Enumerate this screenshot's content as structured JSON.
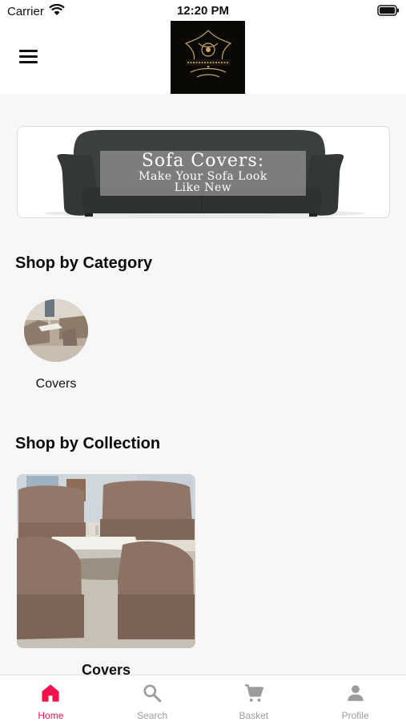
{
  "status_bar": {
    "carrier": "Carrier",
    "time": "12:20 PM"
  },
  "header": {
    "logo_icon": "ornamental-brand-logo"
  },
  "banner": {
    "title": "Sofa Covers:",
    "subtitle_line1": "Make Your Sofa Look",
    "subtitle_line2": "Like New"
  },
  "category_section": {
    "title": "Shop by Category",
    "items": [
      {
        "label": "Covers"
      }
    ]
  },
  "collection_section": {
    "title": "Shop by Collection",
    "items": [
      {
        "label": "Covers"
      }
    ]
  },
  "tab_bar": {
    "tabs": [
      {
        "label": "Home",
        "icon": "home-icon",
        "active": true
      },
      {
        "label": "Search",
        "icon": "search-icon",
        "active": false
      },
      {
        "label": "Basket",
        "icon": "cart-icon",
        "active": false
      },
      {
        "label": "Profile",
        "icon": "person-icon",
        "active": false
      }
    ]
  },
  "colors": {
    "accent": "#f2134c",
    "inactive_tab": "#9c9c9c",
    "background": "#f7f7f7"
  }
}
